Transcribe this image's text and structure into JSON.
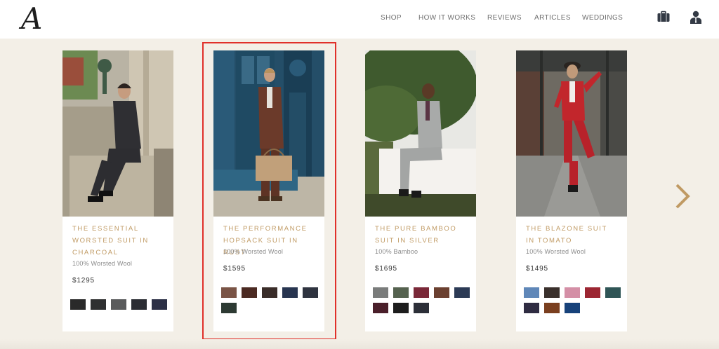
{
  "header": {
    "logo": "A",
    "nav": [
      "SHOP",
      "HOW IT WORKS",
      "REVIEWS",
      "ARTICLES",
      "WEDDINGS"
    ],
    "icons": [
      "briefcase-icon",
      "user-icon"
    ]
  },
  "products": [
    {
      "name": "THE ESSENTIAL WORSTED SUIT IN CHARCOAL",
      "fabric": "100% Worsted Wool",
      "price": "$1295",
      "swatches": [
        "#2a2a2a",
        "#2f3031",
        "#5a5b5c",
        "#2b2d33",
        "#2c3046"
      ]
    },
    {
      "name": "THE PERFORMANCE HOPSACK SUIT IN RUST",
      "fabric": "100% Worsted Wool",
      "price": "$1595",
      "swatches": [
        "#7a5446",
        "#4b2a22",
        "#3a2d29",
        "#283550",
        "#2f3440",
        "#2d3a33"
      ],
      "highlighted": true
    },
    {
      "name": "THE PURE BAMBOO SUIT IN SILVER",
      "fabric": "100% Bamboo",
      "price": "$1695",
      "swatches": [
        "#7a7c7b",
        "#55624f",
        "#7a2838",
        "#6b4030",
        "#2c3a55",
        "#4a1f2a",
        "#1d1d1d",
        "#2c2f38"
      ]
    },
    {
      "name": "THE BLAZONE SUIT IN TOMATO",
      "fabric": "100% Worsted Wool",
      "price": "$1495",
      "swatches": [
        "#5f87b8",
        "#3a302c",
        "#d48fa6",
        "#9c2632",
        "#2f5556",
        "#2f2c42",
        "#7a3f1f",
        "#17427a"
      ]
    }
  ],
  "colors": {
    "accent": "#c09a63",
    "background": "#f3efe7",
    "highlight": "#e0302a"
  }
}
